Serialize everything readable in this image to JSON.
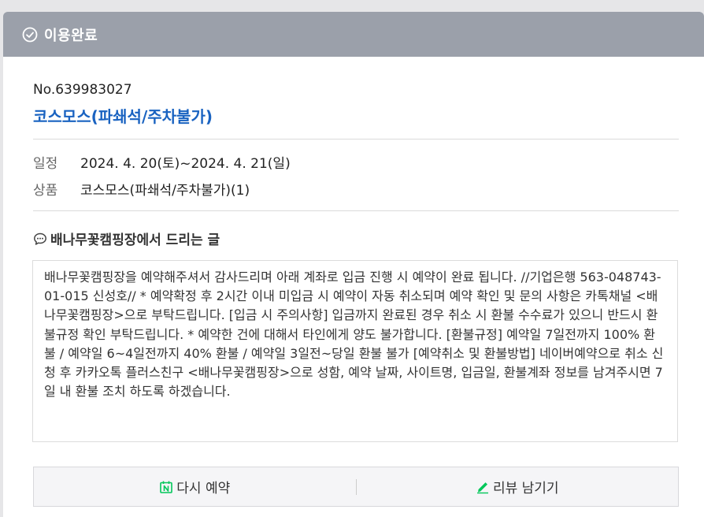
{
  "status": {
    "label": "이용완료",
    "icon": "check-circle-icon"
  },
  "booking": {
    "order_no": "No.639983027",
    "product_title": "코스모스(파쇄석/주차불가)",
    "schedule_key": "일정",
    "schedule_value": "2024. 4. 20(토)~2024. 4. 21(일)",
    "product_key": "상품",
    "product_value": "코스모스(파쇄석/주차불가)(1)"
  },
  "message": {
    "title": "배나무꽃캠핑장에서 드리는 글",
    "icon": "speech-bubble-icon",
    "body": "배나무꽃캠핑장을 예약해주셔서 감사드리며 아래 계좌로 입금 진행 시 예약이 완료 됩니다. //기업은행 563-048743-01-015 신성호// * 예약확정 후 2시간 이내 미입금 시 예약이 자동 취소되며 예약 확인 및 문의 사항은 카톡채널 <배나무꽃캠핑장>으로 부탁드립니다. [입금 시 주의사항] 입금까지 완료된 경우 취소 시 환불 수수료가 있으니 반드시 환불규정 확인 부탁드립니다. * 예약한 건에 대해서 타인에게 양도 불가합니다. [환불규정] 예약일 7일전까지 100% 환불 / 예약일 6~4일전까지 40% 환불 / 예약일 3일전~당일 환불 불가 [예약취소 및 환불방법] 네이버예약으로 취소 신청 후 카카오톡 플러스친구 <배나무꽃캠핑장>으로 성함, 예약 날짜, 사이트명, 입금일, 환불계좌 정보를 남겨주시면 7일 내 환불 조치 하도록 하겠습니다."
  },
  "actions": {
    "rebook_label": "다시 예약",
    "rebook_icon": "naver-calendar-icon",
    "review_label": "리뷰 남기기",
    "review_icon": "pencil-icon"
  },
  "colors": {
    "status_bar": "#9ba0aa",
    "title_blue": "#1a63c1",
    "naver_green": "#03c75a"
  }
}
